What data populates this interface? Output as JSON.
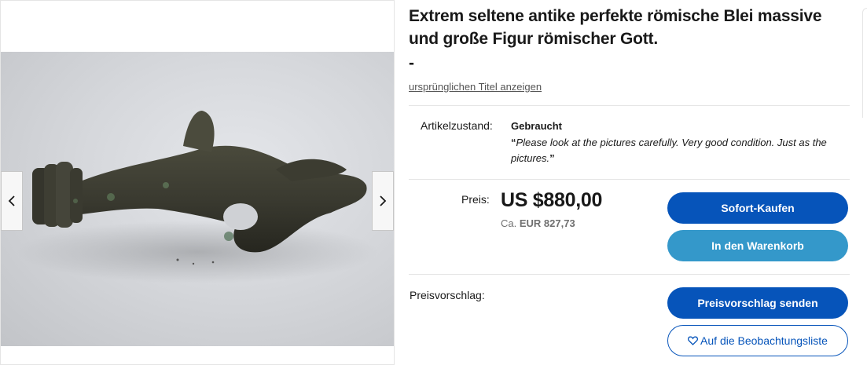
{
  "gallery": {
    "image_alt": "Römische Bleifigur",
    "prev_icon": "chevron-left-icon",
    "next_icon": "chevron-right-icon"
  },
  "listing": {
    "title": "Extrem seltene antike perfekte römische Blei massive und große Figur römischer Gott.",
    "title_suffix": "-",
    "original_title_link": "ursprünglichen Titel anzeigen",
    "condition_label": "Artikelzustand:",
    "condition_value": "Gebraucht",
    "condition_note_open": "“",
    "condition_note": "Please look at the pictures carefully. Very good condition. Just as the pictures.",
    "condition_note_close": "”"
  },
  "price": {
    "label": "Preis:",
    "value": "US $880,00",
    "approx_prefix": "Ca.",
    "approx_value": "EUR 827,73"
  },
  "actions": {
    "buy_now": "Sofort-Kaufen",
    "add_to_cart": "In den Warenkorb",
    "make_offer": "Preisvorschlag senden",
    "watchlist": "Auf die Beobachtungsliste",
    "watchlist_icon": "heart-icon"
  },
  "offer": {
    "label": "Preisvorschlag:"
  },
  "colors": {
    "primary": "#0654ba",
    "secondary": "#3498ca",
    "text": "#191919",
    "muted": "#707070"
  }
}
